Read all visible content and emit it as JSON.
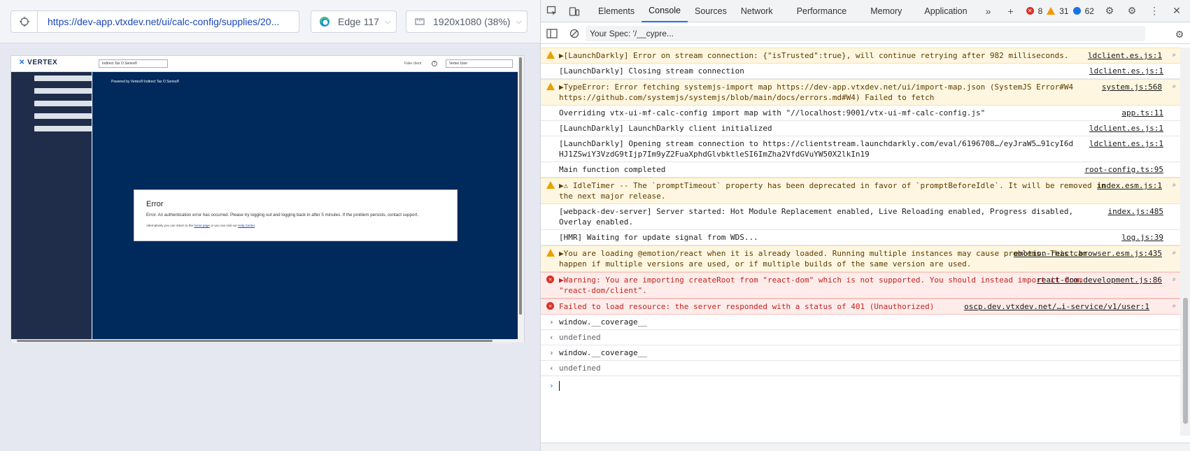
{
  "runner": {
    "url": "https://dev-app.vtxdev.net/ui/calc-config/supplies/20...",
    "browser": "Edge 117",
    "viewport": "1920x1080 (38%)"
  },
  "app": {
    "logo": "VERTEX",
    "product_select": "Indirect Tax O Series®",
    "fake_client": "Fake client",
    "user_select": "Vertex User",
    "powered_by": "Powered by Vertex® Indirect Tax O Series®",
    "error": {
      "title": "Error",
      "message": "Error. An authentication error has occurred. Please try logging out and logging back in after 5 minutes. If the problem persists, contact support.",
      "alt_prefix": "Alternatively you can return to the",
      "home_link": "home page",
      "alt_middle": "or you can visit our",
      "help_link": "Help Center"
    }
  },
  "devtools": {
    "tabs": [
      "Elements",
      "Console",
      "Sources",
      "Network",
      "Performance",
      "Memory",
      "Application"
    ],
    "active_tab": "Console",
    "errors_count": "8",
    "warnings_count": "31",
    "info_count": "62",
    "filter_value": "Your Spec: '/__cypre...",
    "messages": [
      {
        "level": "warning",
        "text": "▶[LaunchDarkly] Error on stream connection: {\"isTrusted\":true}, will continue retrying after 982 milliseconds.",
        "source": "ldclient.es.js:1"
      },
      {
        "level": "info",
        "text": "[LaunchDarkly] Closing stream connection",
        "source": "ldclient.es.js:1"
      },
      {
        "level": "warning",
        "text": "▶TypeError: Error fetching systemjs-import map https://dev-app.vtxdev.net/ui/import-map.json (SystemJS Error#W4 https://github.com/systemjs/systemjs/blob/main/docs/errors.md#W4) Failed to fetch",
        "source": "system.js:568"
      },
      {
        "level": "info",
        "text": "Overriding vtx-ui-mf-calc-config import map with \"//localhost:9001/vtx-ui-mf-calc-config.js\"",
        "source": "app.ts:11"
      },
      {
        "level": "info",
        "text": "[LaunchDarkly] LaunchDarkly client initialized",
        "source": "ldclient.es.js:1"
      },
      {
        "level": "info",
        "text": "[LaunchDarkly] Opening stream connection to https://clientstream.launchdarkly.com/eval/6196708…/eyJraW5…91cyI6d HJ1ZSwiY3VzdG9tIjp7Im9yZ2FuaXphdGlvbktleSI6ImZha2VfdGVuYW50X2lkIn19",
        "source": "ldclient.es.js:1"
      },
      {
        "level": "info",
        "text": "Main function completed",
        "source": "root-config.ts:95"
      },
      {
        "level": "warning",
        "text": "▶⚠ IdleTimer -- The `promptTimeout` property has been deprecated in favor of `promptBeforeIdle`. It will be removed in the next major release.",
        "source": "index.esm.js:1"
      },
      {
        "level": "info",
        "text": "[webpack-dev-server] Server started: Hot Module Replacement enabled, Live Reloading enabled, Progress disabled, Overlay enabled.",
        "source": "index.js:485"
      },
      {
        "level": "info",
        "text": "[HMR] Waiting for update signal from WDS...",
        "source": "log.js:39"
      },
      {
        "level": "warning",
        "text": "▶You are loading @emotion/react when it is already loaded. Running multiple instances may cause problems. This can happen if multiple versions are used, or if multiple builds of the same version are used.",
        "source": "emotion-react.browser.esm.js:435"
      },
      {
        "level": "error",
        "text": "▶Warning: You are importing createRoot from \"react-dom\" which is not supported. You should instead import it from \"react-dom/client\".",
        "source": "react-dom.development.js:86"
      },
      {
        "level": "error",
        "text": "Failed to load resource: the server responded with a status of 401 (Unauthorized)",
        "source": "oscp.dev.vtxdev.net/…i-service/v1/user:1"
      }
    ],
    "repl": [
      {
        "input": "window.__coverage__",
        "result": "undefined"
      },
      {
        "input": "window.__coverage__",
        "result": "undefined"
      }
    ]
  }
}
